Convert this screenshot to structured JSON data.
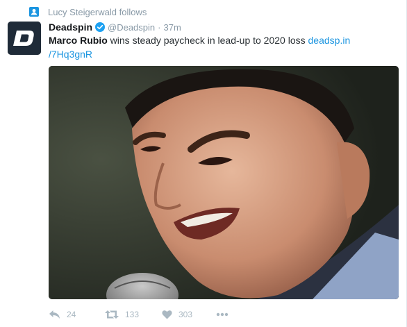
{
  "context": {
    "icon": "user-follow-icon",
    "text": "Lucy Steigerwald follows"
  },
  "author": {
    "avatar_letter": "D",
    "name": "Deadspin",
    "verified": true,
    "handle": "@Deadspin",
    "separator": "·",
    "time": "37m"
  },
  "tweet": {
    "bold_text": "Marco Rubio",
    "text": " wins steady paycheck in lead-up to 2020 loss ",
    "link_line1": "deadsp.in",
    "link_line2": "/7Hq3gnR"
  },
  "media": {
    "description": "photo"
  },
  "actions": {
    "reply_count": "24",
    "retweet_count": "133",
    "like_count": "303"
  },
  "colors": {
    "link": "#1b95e0",
    "muted": "#8899a6",
    "icon": "#aab8c2",
    "avatar_bg": "#1f2b38"
  }
}
